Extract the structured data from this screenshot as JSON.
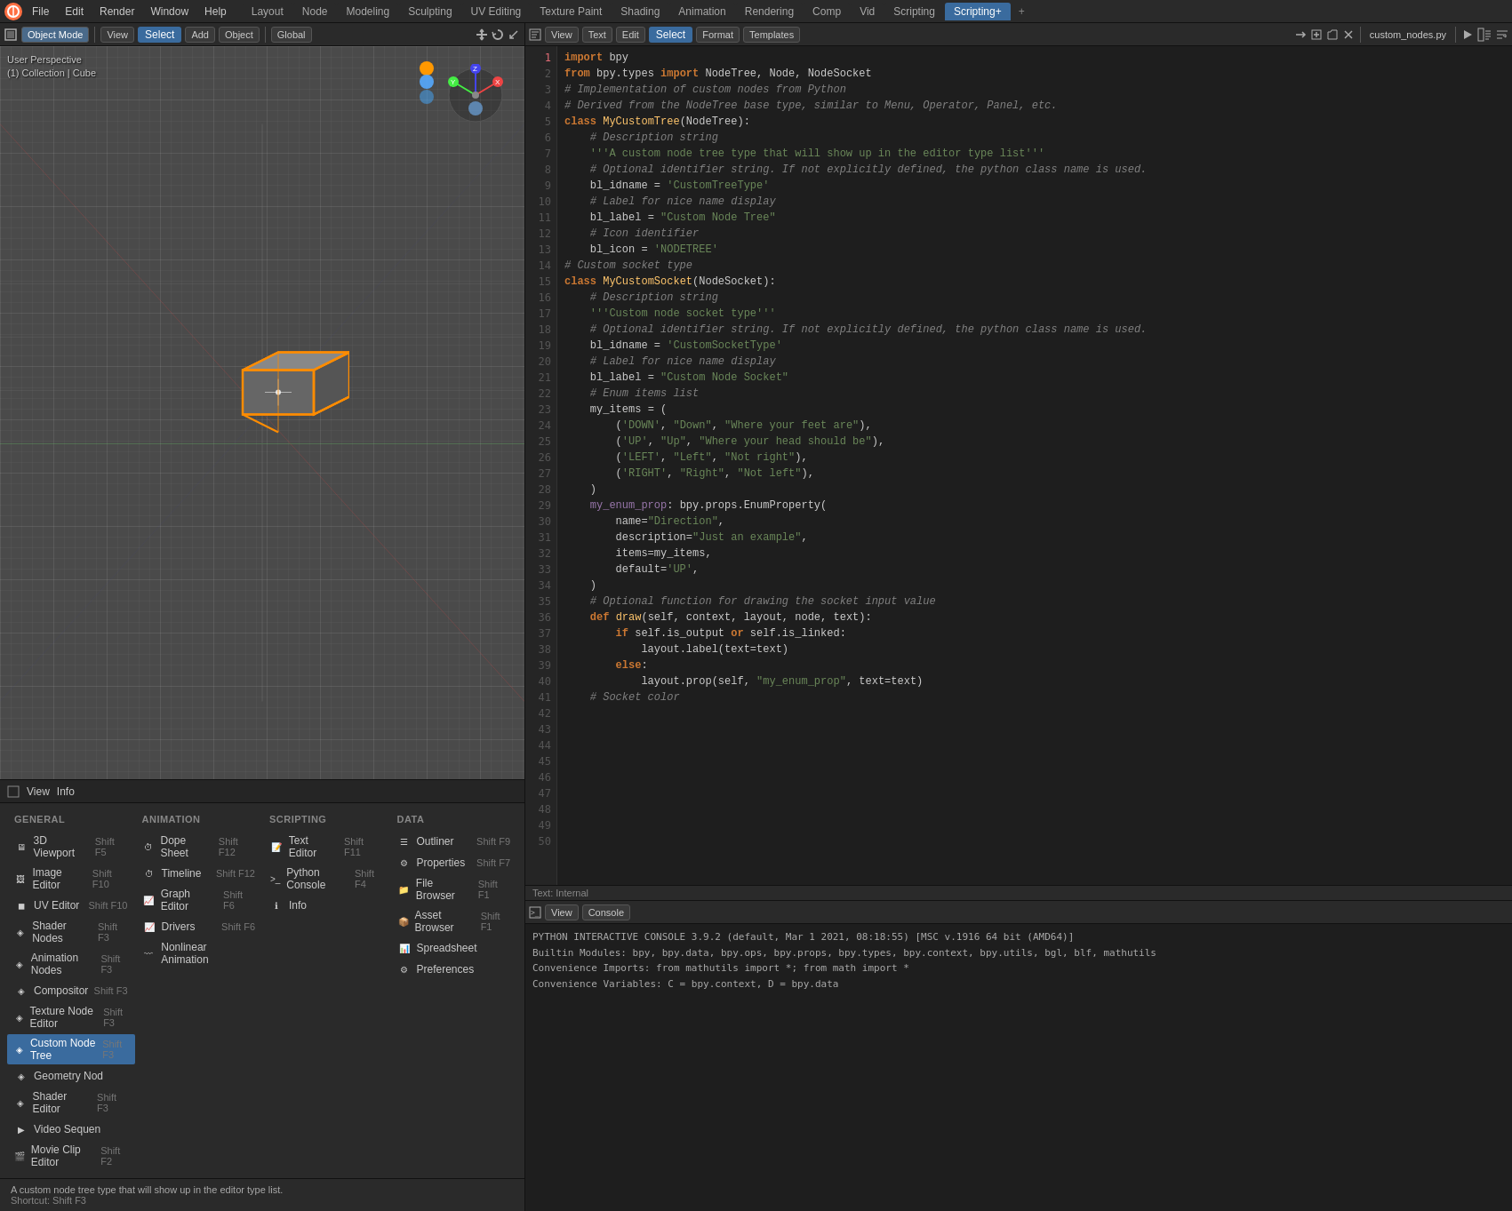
{
  "topMenu": {
    "items": [
      "File",
      "Edit",
      "Render",
      "Window",
      "Help"
    ],
    "tabs": [
      "Layout",
      "Node",
      "Modeling",
      "Sculpting",
      "UV Editing",
      "Texture Paint",
      "Shading",
      "Animation",
      "Rendering",
      "Comp",
      "Vid",
      "Scripting",
      "Scripting+"
    ],
    "activeTab": "Scripting+"
  },
  "viewportToolbar": {
    "editorType": "Object Mode",
    "viewLabel": "View",
    "selectLabel": "Select",
    "addLabel": "Add",
    "objectLabel": "Object",
    "transformGlobal": "Global",
    "info": "User Perspective",
    "collection": "(1) Collection | Cube"
  },
  "codeHeader": {
    "viewLabel": "View",
    "textLabel": "Text",
    "editLabel": "Edit",
    "selectLabel": "Select",
    "formatLabel": "Format",
    "templatesLabel": "Templates",
    "filename": "custom_nodes.py"
  },
  "codeLines": [
    {
      "n": 1,
      "text": "import bpy",
      "type": "code"
    },
    {
      "n": 2,
      "text": "from bpy.types import NodeTree, Node, NodeSocket",
      "type": "code"
    },
    {
      "n": 3,
      "text": "",
      "type": "empty"
    },
    {
      "n": 4,
      "text": "# Implementation of custom nodes from Python",
      "type": "comment"
    },
    {
      "n": 5,
      "text": "",
      "type": "empty"
    },
    {
      "n": 6,
      "text": "",
      "type": "empty"
    },
    {
      "n": 7,
      "text": "# Derived from the NodeTree base type, similar to Menu, Operator, Panel, etc.",
      "type": "comment"
    },
    {
      "n": 8,
      "text": "class MyCustomTree(NodeTree):",
      "type": "code"
    },
    {
      "n": 9,
      "text": "    # Description string",
      "type": "comment"
    },
    {
      "n": 10,
      "text": "    '''A custom node tree type that will show up in the editor type list'''",
      "type": "str"
    },
    {
      "n": 11,
      "text": "    # Optional identifier string. If not explicitly defined, the python class name is used.",
      "type": "comment"
    },
    {
      "n": 12,
      "text": "    bl_idname = 'CustomTreeType'",
      "type": "code"
    },
    {
      "n": 13,
      "text": "    # Label for nice name display",
      "type": "comment"
    },
    {
      "n": 14,
      "text": "    bl_label = \"Custom Node Tree\"",
      "type": "code"
    },
    {
      "n": 15,
      "text": "    # Icon identifier",
      "type": "comment"
    },
    {
      "n": 16,
      "text": "    bl_icon = 'NODETREE'",
      "type": "code"
    },
    {
      "n": 17,
      "text": "",
      "type": "empty"
    },
    {
      "n": 18,
      "text": "",
      "type": "empty"
    },
    {
      "n": 19,
      "text": "# Custom socket type",
      "type": "comment"
    },
    {
      "n": 20,
      "text": "class MyCustomSocket(NodeSocket):",
      "type": "code"
    },
    {
      "n": 21,
      "text": "    # Description string",
      "type": "comment"
    },
    {
      "n": 22,
      "text": "    '''Custom node socket type'''",
      "type": "str"
    },
    {
      "n": 23,
      "text": "    # Optional identifier string. If not explicitly defined, the python class name is used.",
      "type": "comment"
    },
    {
      "n": 24,
      "text": "    bl_idname = 'CustomSocketType'",
      "type": "code"
    },
    {
      "n": 25,
      "text": "    # Label for nice name display",
      "type": "comment"
    },
    {
      "n": 26,
      "text": "    bl_label = \"Custom Node Socket\"",
      "type": "code"
    },
    {
      "n": 27,
      "text": "",
      "type": "empty"
    },
    {
      "n": 28,
      "text": "    # Enum items list",
      "type": "comment"
    },
    {
      "n": 29,
      "text": "    my_items = (",
      "type": "code"
    },
    {
      "n": 30,
      "text": "        ('DOWN', \"Down\", \"Where your feet are\"),",
      "type": "code"
    },
    {
      "n": 31,
      "text": "        ('UP', \"Up\", \"Where your head should be\"),",
      "type": "code"
    },
    {
      "n": 32,
      "text": "        ('LEFT', \"Left\", \"Not right\"),",
      "type": "code"
    },
    {
      "n": 33,
      "text": "        ('RIGHT', \"Right\", \"Not left\"),",
      "type": "code"
    },
    {
      "n": 34,
      "text": "    )",
      "type": "code"
    },
    {
      "n": 35,
      "text": "",
      "type": "empty"
    },
    {
      "n": 36,
      "text": "    my_enum_prop: bpy.props.EnumProperty(",
      "type": "code"
    },
    {
      "n": 37,
      "text": "        name=\"Direction\",",
      "type": "code"
    },
    {
      "n": 38,
      "text": "        description=\"Just an example\",",
      "type": "code"
    },
    {
      "n": 39,
      "text": "        items=my_items,",
      "type": "code"
    },
    {
      "n": 40,
      "text": "        default='UP',",
      "type": "code"
    },
    {
      "n": 41,
      "text": "    )",
      "type": "code"
    },
    {
      "n": 42,
      "text": "",
      "type": "empty"
    },
    {
      "n": 43,
      "text": "    # Optional function for drawing the socket input value",
      "type": "comment"
    },
    {
      "n": 44,
      "text": "    def draw(self, context, layout, node, text):",
      "type": "code"
    },
    {
      "n": 45,
      "text": "        if self.is_output or self.is_linked:",
      "type": "code"
    },
    {
      "n": 46,
      "text": "            layout.label(text=text)",
      "type": "code"
    },
    {
      "n": 47,
      "text": "        else:",
      "type": "code"
    },
    {
      "n": 48,
      "text": "            layout.prop(self, \"my_enum_prop\", text=text)",
      "type": "code"
    },
    {
      "n": 49,
      "text": "",
      "type": "empty"
    },
    {
      "n": 50,
      "text": "    # Socket color",
      "type": "comment"
    }
  ],
  "codeFooter": "Text: Internal",
  "overlayMenu": {
    "headerItems": [
      "View",
      "Info"
    ],
    "columns": [
      {
        "label": "General",
        "items": [
          {
            "icon": "3d",
            "label": "3D Viewport",
            "shortcut": "Shift F5"
          },
          {
            "icon": "img",
            "label": "Image Editor",
            "shortcut": "Shift F10"
          },
          {
            "icon": "uv",
            "label": "UV Editor",
            "shortcut": "Shift F10"
          },
          {
            "icon": "nodes",
            "label": "Shader Nodes",
            "shortcut": "Shift F3"
          },
          {
            "icon": "anim",
            "label": "Animation Nodes",
            "shortcut": "Shift F3"
          },
          {
            "icon": "comp",
            "label": "Compositor",
            "shortcut": "Shift F3"
          },
          {
            "icon": "tex",
            "label": "Texture Node Editor",
            "shortcut": "Shift F3"
          },
          {
            "icon": "cust",
            "label": "Custom Node Tree",
            "shortcut": "Shift F3",
            "selected": true
          },
          {
            "icon": "geo",
            "label": "Geometry Nod",
            "shortcut": ""
          },
          {
            "icon": "shader2",
            "label": "Shader Editor",
            "shortcut": "Shift F3"
          },
          {
            "icon": "video",
            "label": "Video Sequen",
            "shortcut": ""
          },
          {
            "icon": "movie",
            "label": "Movie Clip Editor",
            "shortcut": "Shift F2"
          }
        ]
      },
      {
        "label": "Animation",
        "items": [
          {
            "icon": "dope",
            "label": "Dope Sheet",
            "shortcut": "Shift F12"
          },
          {
            "icon": "timeline",
            "label": "Timeline",
            "shortcut": "Shift F12"
          },
          {
            "icon": "graph",
            "label": "Graph Editor",
            "shortcut": "Shift F6"
          },
          {
            "icon": "drivers",
            "label": "Drivers",
            "shortcut": "Shift F6"
          },
          {
            "icon": "nonlinear",
            "label": "Nonlinear Animation",
            "shortcut": ""
          }
        ]
      },
      {
        "label": "Scripting",
        "items": [
          {
            "icon": "text",
            "label": "Text Editor",
            "shortcut": "Shift F11"
          },
          {
            "icon": "python",
            "label": "Python Console",
            "shortcut": "Shift F4"
          },
          {
            "icon": "info",
            "label": "Info",
            "shortcut": ""
          }
        ]
      },
      {
        "label": "Data",
        "items": [
          {
            "icon": "outliner",
            "label": "Outliner",
            "shortcut": "Shift F9"
          },
          {
            "icon": "props",
            "label": "Properties",
            "shortcut": "Shift F7"
          },
          {
            "icon": "file",
            "label": "File Browser",
            "shortcut": "Shift F1"
          },
          {
            "icon": "asset",
            "label": "Asset Browser",
            "shortcut": "Shift F1"
          },
          {
            "icon": "spread",
            "label": "Spreadsheet",
            "shortcut": ""
          },
          {
            "icon": "prefs",
            "label": "Preferences",
            "shortcut": ""
          }
        ]
      }
    ],
    "tooltip": "A custom node tree type that will show up in the editor type list.",
    "tooltipShortcut": "Shortcut: Shift F3"
  },
  "console": {
    "header": {
      "viewLabel": "View",
      "consoleLabel": "Console"
    },
    "lines": [
      "PYTHON INTERACTIVE CONSOLE 3.9.2 (default, Mar  1 2021, 08:18:55) [MSC v.1916 64 bit (AMD64)]",
      "Builtin Modules:       bpy, bpy.data, bpy.ops, bpy.props, bpy.types, bpy.context, bpy.utils, bgl, blf, mathutils",
      "Convenience Imports:   from mathutils import *; from math import *",
      "Convenience Variables: C = bpy.context, D = bpy.data"
    ]
  }
}
